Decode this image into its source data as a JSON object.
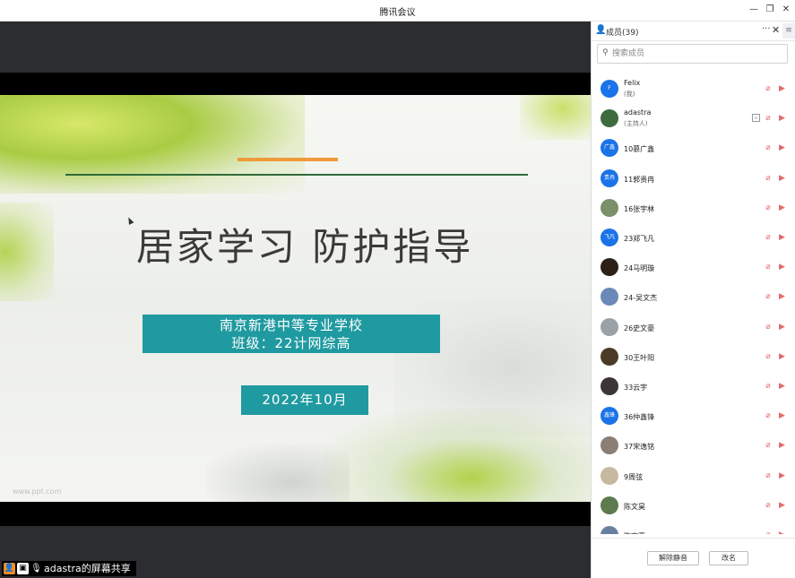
{
  "window": {
    "title": "腾讯会议",
    "minimize": "—",
    "restore": "❐",
    "close": "✕"
  },
  "slide": {
    "title": "居家学习  防护指导",
    "school": "南京新港中等专业学校",
    "class": "班级：22计网综高",
    "date": "2022年10月",
    "watermark": "www.ppt.com"
  },
  "share_label": {
    "text": "adastra的屏幕共享"
  },
  "panel": {
    "header": "成员(39)",
    "more": "···",
    "close": "✕",
    "menu": "≡",
    "search_placeholder": "搜索成员",
    "members": [
      {
        "name": "Felix",
        "sub": "(我)",
        "avatar_text": "F",
        "avatar_color": "#1a73e8",
        "share": false
      },
      {
        "name": "adastra",
        "sub": "(主持人)",
        "avatar_text": "",
        "avatar_color": "#3d6b3e",
        "share": true
      },
      {
        "name": "10慕广鑫",
        "sub": "",
        "avatar_text": "广鑫",
        "avatar_color": "#1a73e8",
        "share": false
      },
      {
        "name": "11郭贵冉",
        "sub": "",
        "avatar_text": "贵冉",
        "avatar_color": "#1a73e8",
        "share": false
      },
      {
        "name": "16张宇林",
        "sub": "",
        "avatar_text": "",
        "avatar_color": "#7b8f6a",
        "share": false
      },
      {
        "name": "23郑飞凡",
        "sub": "",
        "avatar_text": "飞凡",
        "avatar_color": "#1a73e8",
        "share": false
      },
      {
        "name": "24马明璇",
        "sub": "",
        "avatar_text": "",
        "avatar_color": "#2b2118",
        "share": false
      },
      {
        "name": "24-吴文杰",
        "sub": "",
        "avatar_text": "",
        "avatar_color": "#6a89b8",
        "share": false
      },
      {
        "name": "26史文豪",
        "sub": "",
        "avatar_text": "",
        "avatar_color": "#9aa2a8",
        "share": false
      },
      {
        "name": "30王叶阳",
        "sub": "",
        "avatar_text": "",
        "avatar_color": "#4a3a26",
        "share": false
      },
      {
        "name": "33云宇",
        "sub": "",
        "avatar_text": "",
        "avatar_color": "#3b3535",
        "share": false
      },
      {
        "name": "36仲鑫锋",
        "sub": "",
        "avatar_text": "鑫锋",
        "avatar_color": "#1a73e8",
        "share": false
      },
      {
        "name": "37宋逸铭",
        "sub": "",
        "avatar_text": "",
        "avatar_color": "#8a7f76",
        "share": false
      },
      {
        "name": "9周弦",
        "sub": "",
        "avatar_text": "",
        "avatar_color": "#c6b9a0",
        "share": false
      },
      {
        "name": "陈文昊",
        "sub": "",
        "avatar_text": "",
        "avatar_color": "#5d7a4e",
        "share": false
      },
      {
        "name": "陈宇豪",
        "sub": "",
        "avatar_text": "",
        "avatar_color": "#6a7fa0",
        "share": false
      }
    ],
    "footer": {
      "unmute_all": "解除静音",
      "rename": "改名"
    }
  },
  "icons": {
    "mic_off": "mic-off-icon",
    "cam_off": "camera-off-icon",
    "search": "search-icon",
    "person": "person-icon"
  }
}
